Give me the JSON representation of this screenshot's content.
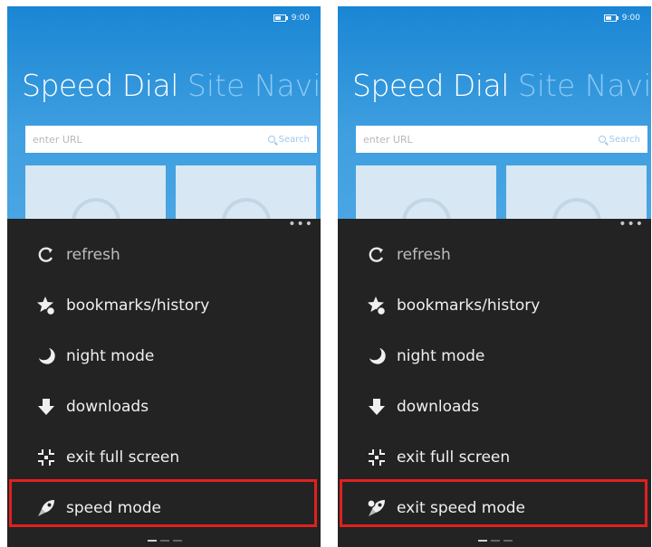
{
  "phones": [
    {
      "status": {
        "time": "9:00"
      },
      "pivot": {
        "title": "Speed Dial",
        "next": "Site Navi"
      },
      "url_bar": {
        "placeholder": "enter URL",
        "search_label": "Search"
      },
      "menu": {
        "items": [
          {
            "icon": "refresh-icon",
            "label": "refresh"
          },
          {
            "icon": "bookmark-star-icon",
            "label": "bookmarks/history"
          },
          {
            "icon": "moon-icon",
            "label": "night mode"
          },
          {
            "icon": "download-arrow-icon",
            "label": "downloads"
          },
          {
            "icon": "exit-fullscreen-icon",
            "label": "exit full screen"
          },
          {
            "icon": "rocket-icon",
            "label": "speed mode"
          }
        ]
      }
    },
    {
      "status": {
        "time": "9:00"
      },
      "pivot": {
        "title": "Speed Dial",
        "next": "Site Navi"
      },
      "url_bar": {
        "placeholder": "enter URL",
        "search_label": "Search"
      },
      "menu": {
        "items": [
          {
            "icon": "refresh-icon",
            "label": "refresh"
          },
          {
            "icon": "bookmark-star-icon",
            "label": "bookmarks/history"
          },
          {
            "icon": "moon-icon",
            "label": "night mode"
          },
          {
            "icon": "download-arrow-icon",
            "label": "downloads"
          },
          {
            "icon": "exit-fullscreen-icon",
            "label": "exit full screen"
          },
          {
            "icon": "rocket-off-icon",
            "label": "exit speed mode"
          }
        ]
      }
    }
  ],
  "colors": {
    "accent": "#2a8fd8",
    "menu_bg": "#232323",
    "highlight": "#e02020"
  }
}
